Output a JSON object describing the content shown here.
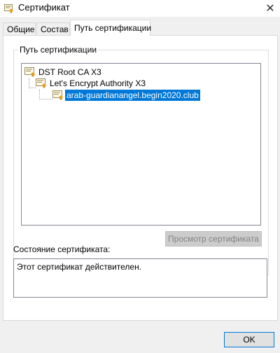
{
  "window": {
    "title": "Сертификат",
    "close_label": "✕"
  },
  "tabs": [
    {
      "label": "Общие"
    },
    {
      "label": "Состав"
    },
    {
      "label": "Путь сертификации"
    }
  ],
  "cert_path": {
    "group_label": "Путь сертификации",
    "nodes": [
      {
        "label": "DST Root CA X3"
      },
      {
        "label": "Let's Encrypt Authority X3"
      },
      {
        "label": "arab-guardianangel.begin2020.club"
      }
    ],
    "view_button_label": "Просмотр сертификата"
  },
  "status": {
    "label": "Состояние сертификата:",
    "text": "Этот сертификат действителен."
  },
  "ok_button_label": "OK",
  "colors": {
    "selection": "#0078d7",
    "cert_ribbon": "#e8a020"
  },
  "icons": [
    "certificate-icon"
  ]
}
